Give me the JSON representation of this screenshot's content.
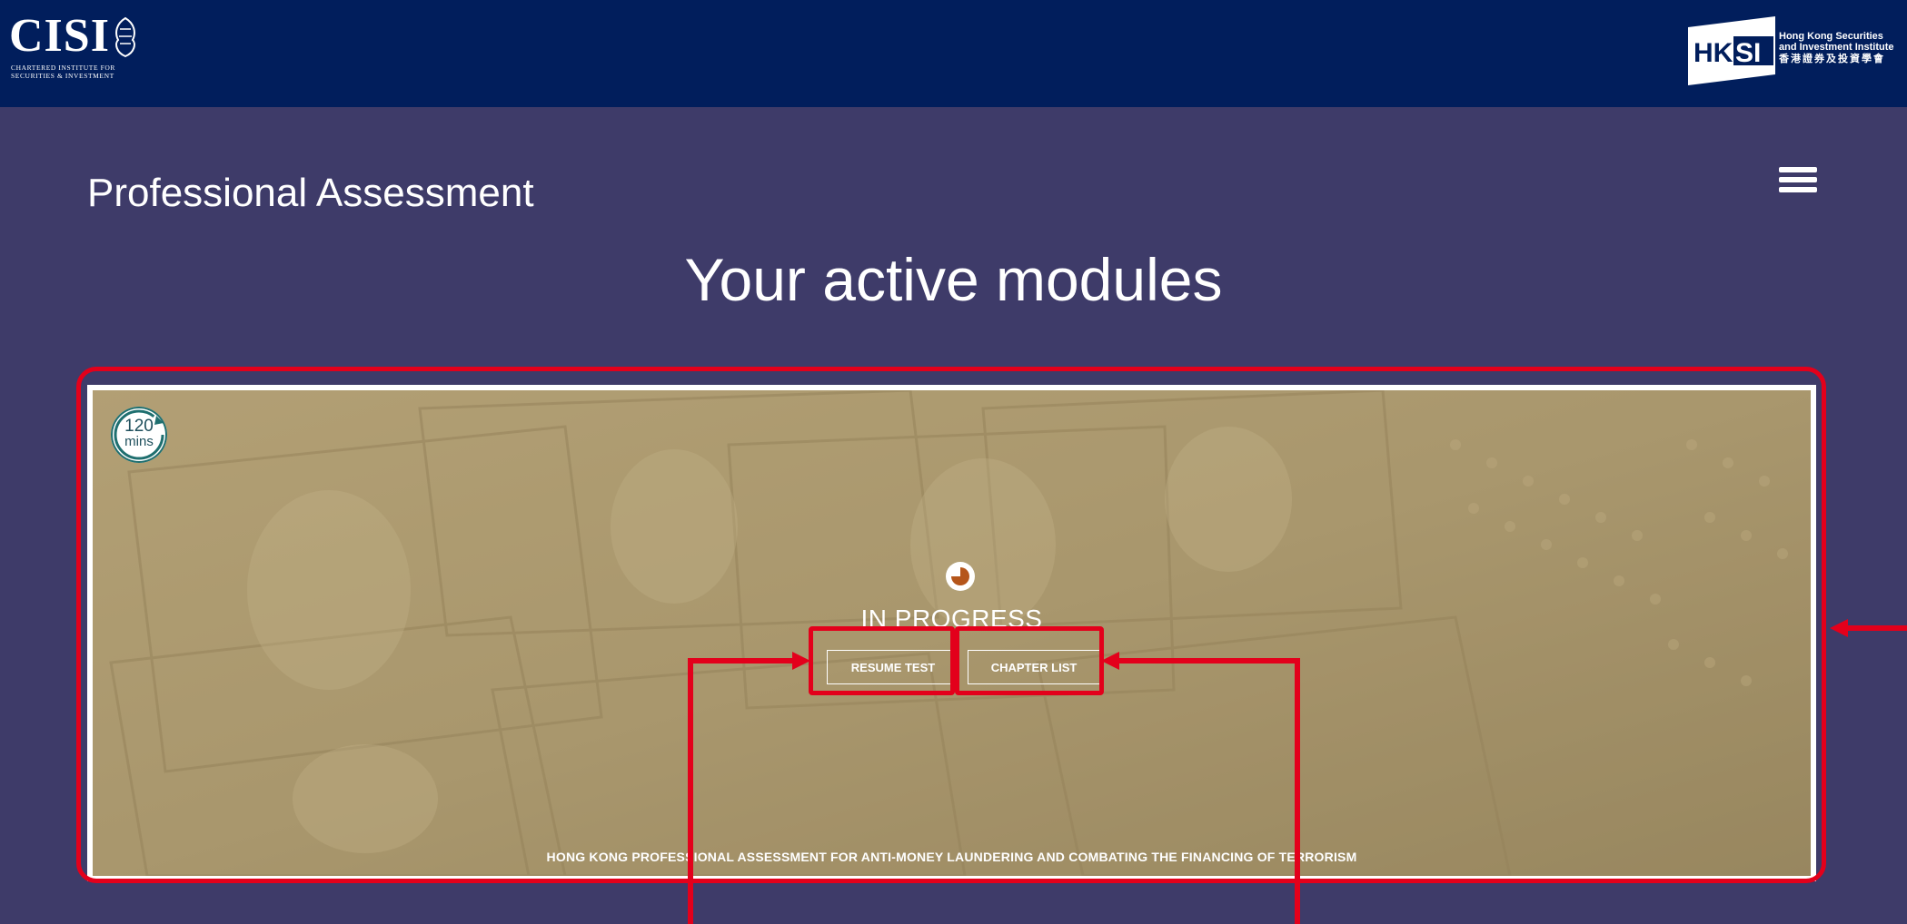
{
  "header": {
    "cisi_logo": {
      "wordmark": "CISI",
      "subtitle_line1": "CHARTERED INSTITUTE FOR",
      "subtitle_line2": "SECURITIES & INVESTMENT"
    },
    "hksi_logo": {
      "mark": "HKSI",
      "line1": "Hong Kong Securities",
      "line2": "and Investment Institute",
      "line3": "香港證券及投資學會"
    },
    "background_color": "#011e5c"
  },
  "page": {
    "title": "Professional Assessment",
    "section_heading": "Your active modules",
    "background_color": "#3e3b69"
  },
  "module_card": {
    "duration_value": "120",
    "duration_unit": "mins",
    "status": "IN PROGRESS",
    "status_icon": "pie-progress-icon",
    "status_icon_color": "#b5561b",
    "resume_button_label": "RESUME TEST",
    "chapter_button_label": "CHAPTER LIST",
    "module_title": "HONG KONG PROFESSIONAL ASSESSMENT FOR ANTI-MONEY LAUNDERING AND COMBATING THE FINANCING OF TERRORISM",
    "background_image": "banknotes-photo"
  },
  "annotations": {
    "color": "#e3001b"
  }
}
